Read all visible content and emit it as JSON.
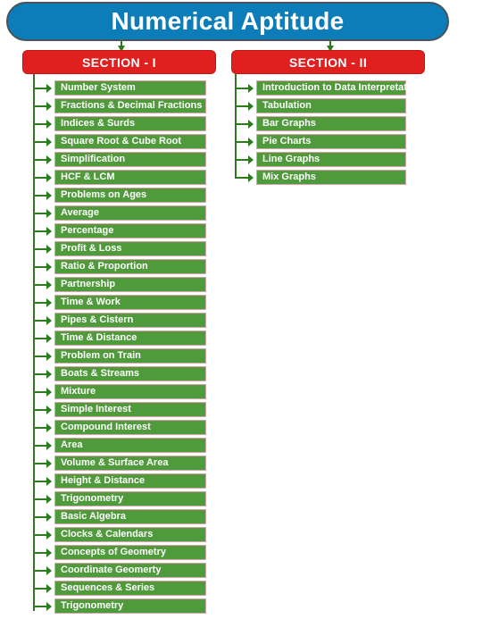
{
  "title": {
    "text": "Numerical Aptitude",
    "background_color": "#0d7dba",
    "text_color": "#ffffff"
  },
  "connector": {
    "color": "#2d7a1f",
    "arrow_icon": "down-arrow-icon",
    "branch_icon": "right-arrow-icon"
  },
  "sections": [
    {
      "header": "SECTION - I",
      "header_color": "#e01f1f",
      "item_color": "#4f9a3b",
      "item_border_color": "#d9a3ab",
      "items": [
        "Number System",
        "Fractions & Decimal Fractions",
        "Indices & Surds",
        "Square Root & Cube Root",
        "Simplification",
        "HCF & LCM",
        "Problems on Ages",
        "Average",
        "Percentage",
        "Profit & Loss",
        "Ratio & Proportion",
        "Partnership",
        "Time & Work",
        "Pipes & Cistern",
        "Time & Distance",
        "Problem on Train",
        "Boats & Streams",
        "Mixture",
        "Simple Interest",
        "Compound Interest",
        "Area",
        "Volume & Surface Area",
        "Height & Distance",
        "Trigonometry",
        "Basic Algebra",
        "Clocks & Calendars",
        "Concepts of Geometry",
        "Coordinate Geomerty",
        "Sequences & Series",
        "Trigonometry"
      ]
    },
    {
      "header": "SECTION - II",
      "header_color": "#e01f1f",
      "item_color": "#4f9a3b",
      "item_border_color": "#d9a3ab",
      "items": [
        "Introduction to Data Interpretation",
        "Tabulation",
        "Bar Graphs",
        "Pie Charts",
        "Line Graphs",
        "Mix Graphs"
      ]
    }
  ]
}
